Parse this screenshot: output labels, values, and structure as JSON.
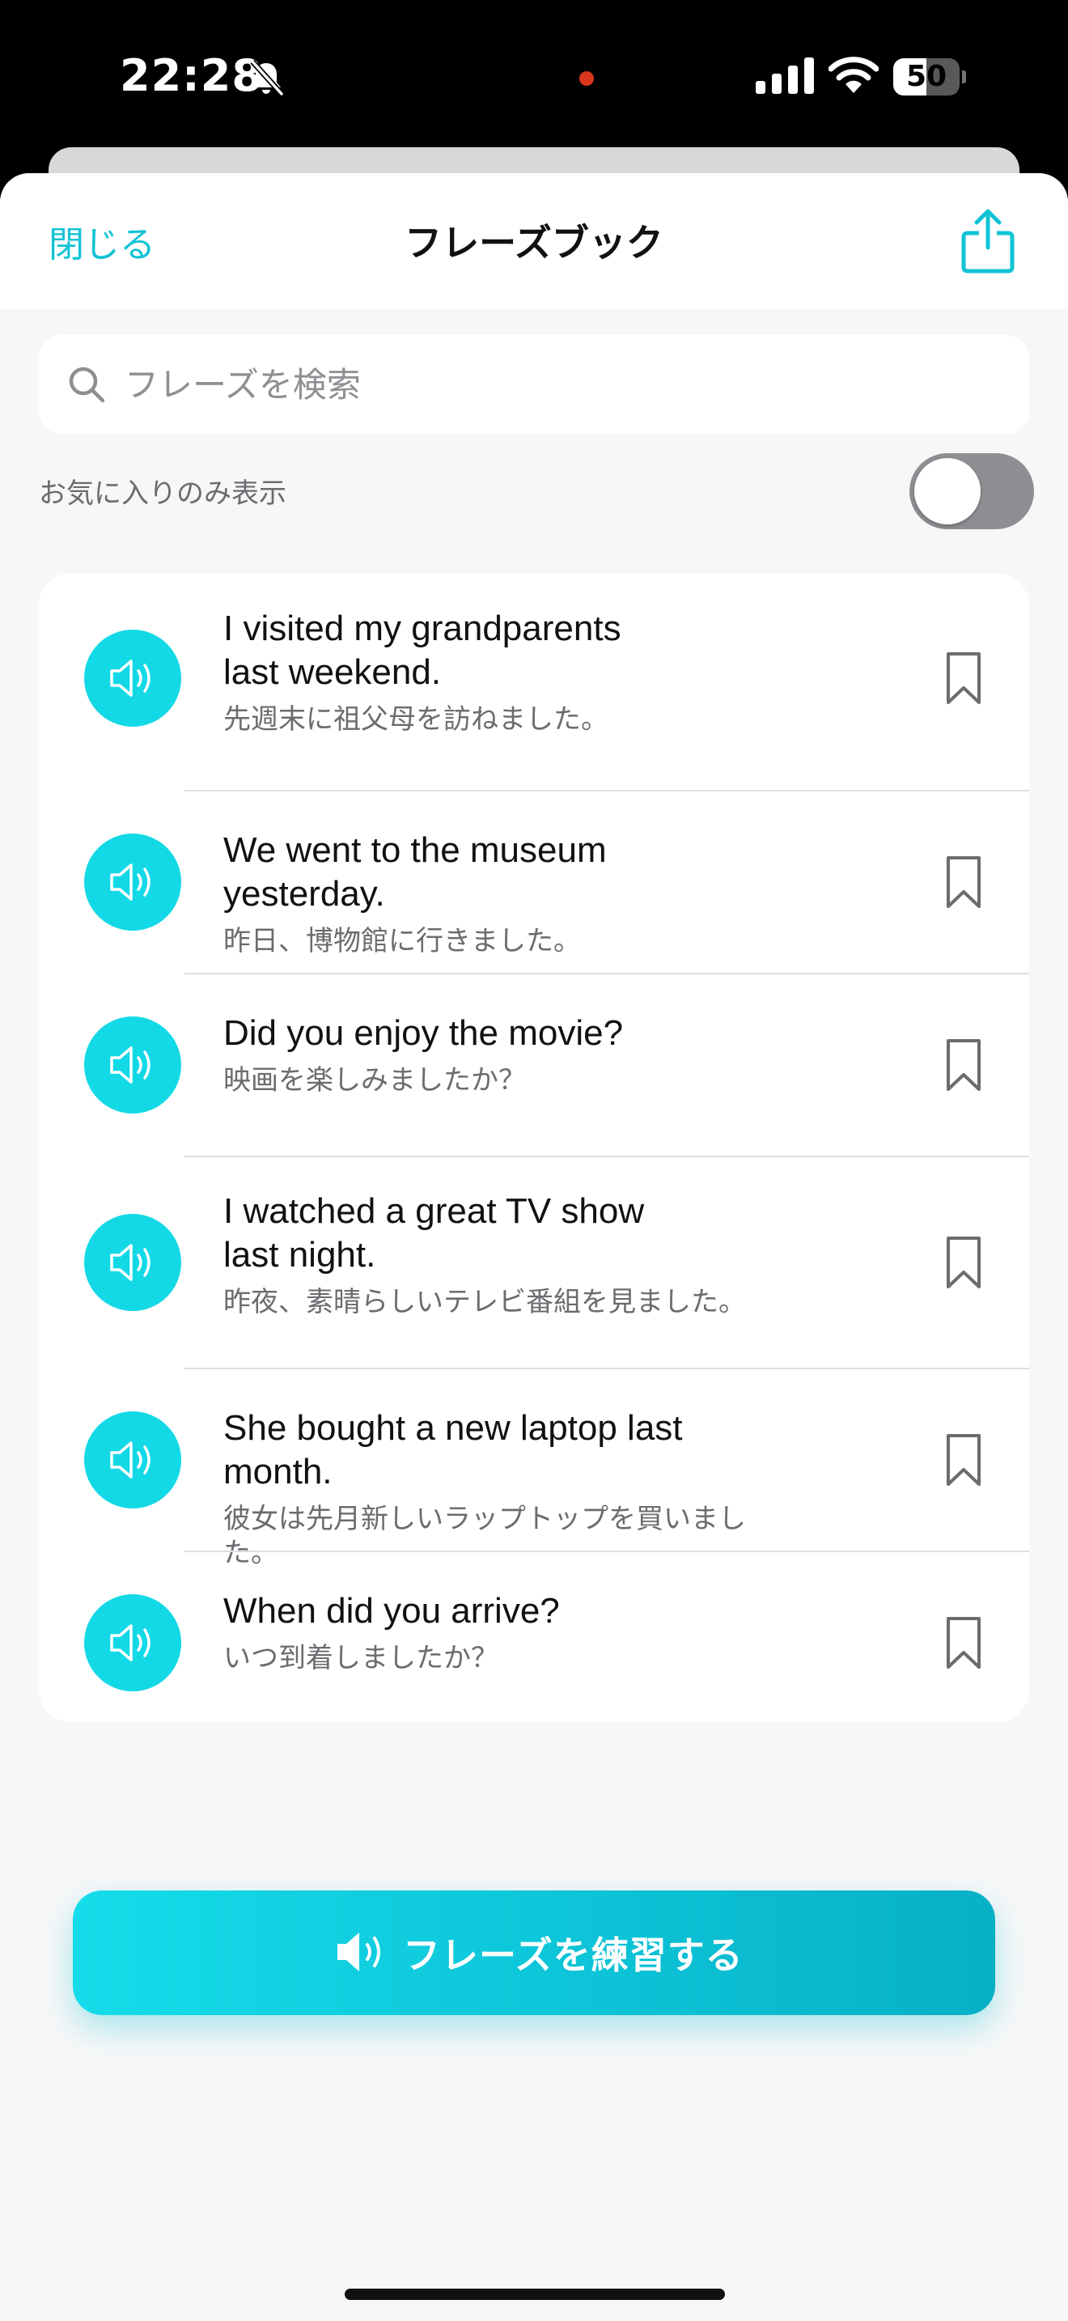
{
  "status_bar": {
    "time": "22:28",
    "battery": "50",
    "battery_level": 0.5,
    "icons": [
      "bell-slash-icon",
      "signal-icon",
      "wifi-icon",
      "battery-icon"
    ]
  },
  "header": {
    "close_label": "閉じる",
    "title": "フレーズブック",
    "share_icon": "share-icon"
  },
  "search": {
    "placeholder": "フレーズを検索",
    "value": ""
  },
  "filter": {
    "favorites_label": "お気に入りのみ表示",
    "favorites_only": false
  },
  "phrases": [
    {
      "english": "I visited my grandparents\nlast weekend.",
      "japanese": "先週末に祖父母を訪ねました。",
      "bookmarked": false
    },
    {
      "english": "We went to the museum yesterday.",
      "japanese": "昨日、博物館に行きました。",
      "bookmarked": false
    },
    {
      "english": "Did you enjoy the movie?",
      "japanese": "映画を楽しみましたか？",
      "bookmarked": false
    },
    {
      "english": "I watched a great TV show\nlast night.",
      "japanese": "昨夜、素晴らしいテレビ番組を見ました。",
      "bookmarked": false
    },
    {
      "english": "She bought a new laptop last month.",
      "japanese": "彼女は先月新しいラップトップを買いました。",
      "bookmarked": false
    },
    {
      "english": "When did you arrive?",
      "japanese": "いつ到着しましたか？",
      "bookmarked": false
    }
  ],
  "footer": {
    "practice_label": "フレーズを練習する",
    "practice_icon": "speaker-icon"
  },
  "colors": {
    "accent": "#10c3d4",
    "speaker_button": "#13d9e6",
    "toggle_off": "#8e8e93",
    "background": "#f7f7f8"
  }
}
